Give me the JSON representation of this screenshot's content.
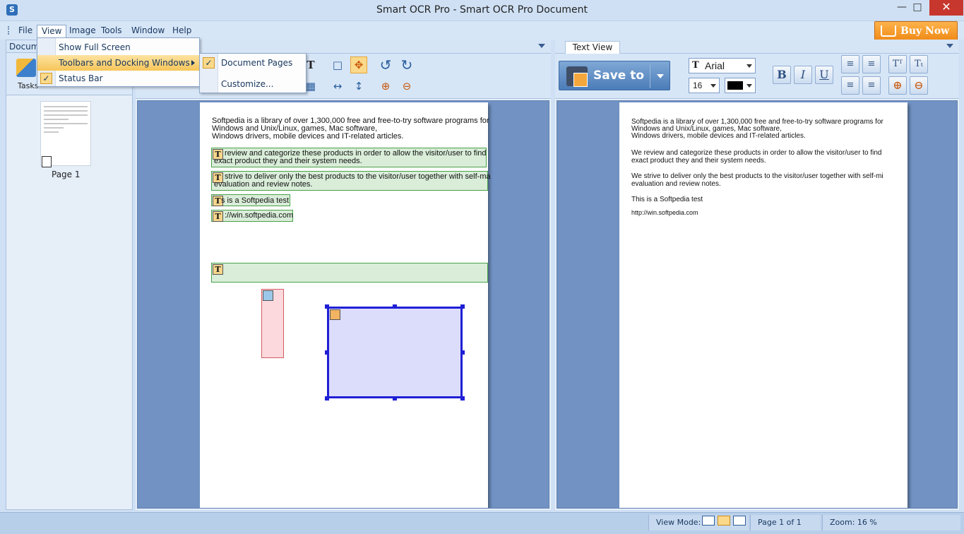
{
  "window": {
    "title": "Smart OCR Pro - Smart OCR Pro Document",
    "icon": "s-app-icon"
  },
  "menu": {
    "items": [
      "File",
      "View",
      "Image",
      "Tools",
      "Window",
      "Help"
    ],
    "active": "View",
    "buy_now": "Buy Now"
  },
  "view_menu": {
    "items": [
      {
        "label": "Show Full Screen",
        "checked": false,
        "submenu": false
      },
      {
        "label": "Toolbars and Docking Windows",
        "checked": false,
        "submenu": true,
        "highlighted": true
      },
      {
        "label": "Status Bar",
        "checked": true,
        "submenu": false
      }
    ]
  },
  "toolbars_submenu": {
    "items": [
      {
        "label": "Document Pages",
        "checked": true
      },
      {
        "label": "Customize...",
        "checked": false
      }
    ]
  },
  "left_panel": {
    "header": "Documen",
    "tasks_label": "Tasks",
    "page_label": "Page 1"
  },
  "right_panel": {
    "tab": "Text View",
    "save_to": "Save to",
    "font_name": "Arial",
    "font_size": "16",
    "text_color": "#000000"
  },
  "document": {
    "ocr_lines": [
      "Softpedia is a library of over 1,300,000 free and free-to-try software programs for",
      " Windows and Unix/Linux, games, Mac software,",
      "Windows drivers, mobile devices and IT-related articles."
    ],
    "zone_lines": [
      " review and categorize these products in order to allow the visitor/user to find",
      "exact product they and their system needs.",
      " strive to deliver only the best products to the visitor/user together with self-ma",
      "evaluation and review notes.",
      "s is a Softpedia test",
      "://win.softpedia.com"
    ],
    "zone_tag": "T"
  },
  "text_view": {
    "lines": [
      "Softpedia is a library of over 1,300,000 free and free-to-try software programs for",
      "Windows and Unix/Linux, games, Mac software,",
      "Windows drivers, mobile devices and IT-related articles.",
      "We review and categorize these products in order to allow the visitor/user to find",
      "exact product they and their system needs.",
      "We strive to deliver only the best products to the visitor/user together with self-mi",
      "evaluation and review notes.",
      "This is a Softpedia test",
      "http://win.softpedia.com"
    ]
  },
  "status": {
    "view_mode_label": "View Mode:",
    "page_info": "Page 1 of 1",
    "zoom": "Zoom: 16 %"
  },
  "colors": {
    "accent": "#fbd98a",
    "window_bg": "#cfe0f4",
    "canvas_bg": "#7192c3",
    "text_zone": "#49a049",
    "table_zone": "#1f1fd6",
    "image_zone": "#d35c63",
    "buy_now": "#f08a16"
  }
}
